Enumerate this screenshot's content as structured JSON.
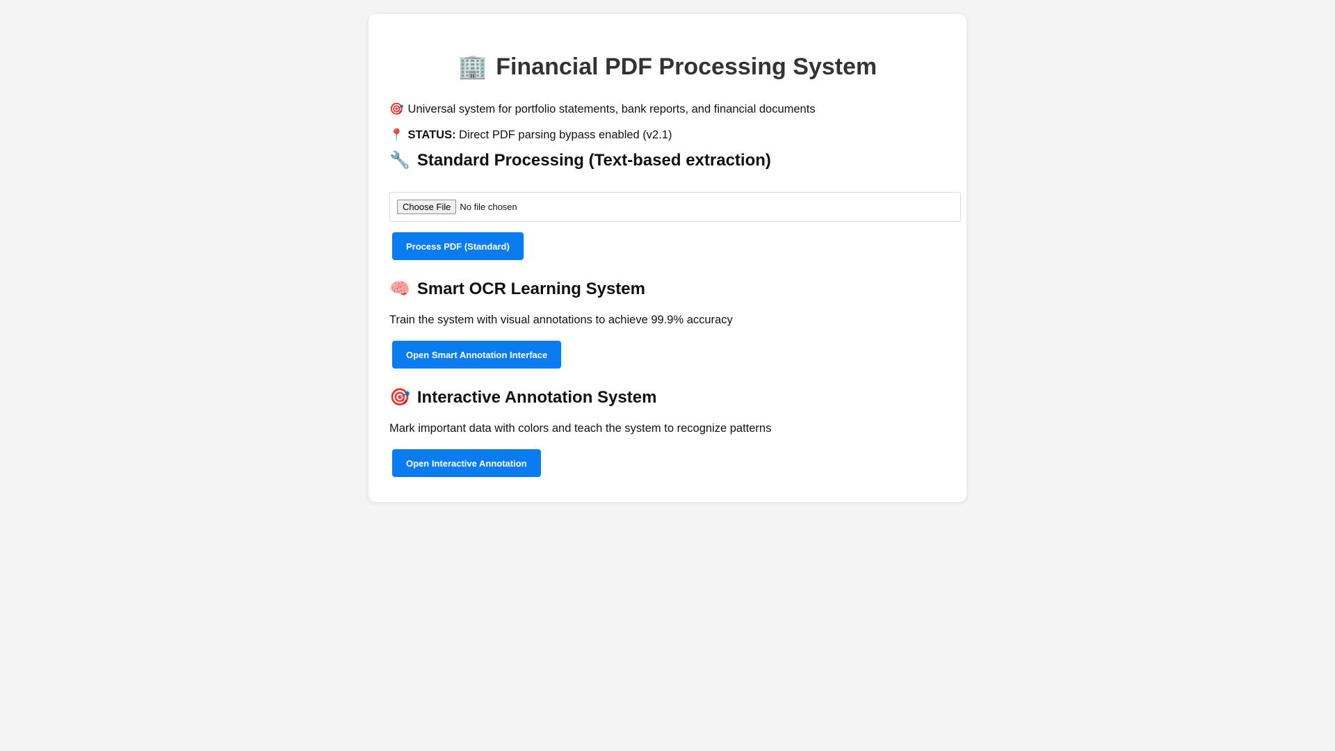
{
  "header": {
    "icon": "🏢",
    "title": "Financial PDF Processing System"
  },
  "intro": {
    "description_icon": "🎯",
    "description": "Universal system for portfolio statements, bank reports, and financial documents",
    "status_icon": "📍",
    "status_label": "STATUS:",
    "status_text": " Direct PDF parsing bypass enabled (v2.1)"
  },
  "standard": {
    "icon": "🔧",
    "heading": "Standard Processing (Text-based extraction)",
    "file_button": "Choose File",
    "file_status": "No file chosen",
    "process_button": "Process PDF (Standard)"
  },
  "smart_ocr": {
    "icon": "🧠",
    "heading": "Smart OCR Learning System",
    "description": "Train the system with visual annotations to achieve 99.9% accuracy",
    "button": "Open Smart Annotation Interface"
  },
  "interactive": {
    "icon": "🎯",
    "heading": "Interactive Annotation System",
    "description": "Mark important data with colors and teach the system to recognize patterns",
    "button": "Open Interactive Annotation"
  },
  "colors": {
    "primary_button": "#0a7cf0",
    "page_background": "#f4f4f4",
    "card_background": "#ffffff"
  }
}
